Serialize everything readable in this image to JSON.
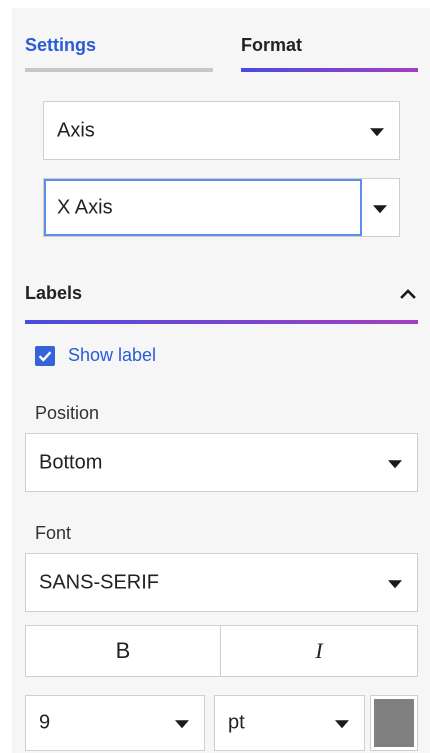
{
  "tabs": {
    "settings": {
      "label": "Settings"
    },
    "format": {
      "label": "Format"
    }
  },
  "axis_select": {
    "value": "Axis"
  },
  "axis_target": {
    "value": "X Axis"
  },
  "labels_section": {
    "title": "Labels",
    "show_label": {
      "label": "Show label",
      "checked": true
    },
    "position": {
      "label": "Position",
      "value": "Bottom"
    },
    "font": {
      "label": "Font",
      "family": "SANS-SERIF",
      "bold_label": "B",
      "italic_label": "I",
      "size": "9",
      "unit": "pt",
      "color": "#808080"
    }
  },
  "colors": {
    "accent_blue": "#2a5ad8",
    "gradient_start": "#4a4be0",
    "gradient_end": "#a33fc0"
  },
  "icons": [
    "chevron-down-icon",
    "chevron-up-icon",
    "checkmark-icon"
  ]
}
